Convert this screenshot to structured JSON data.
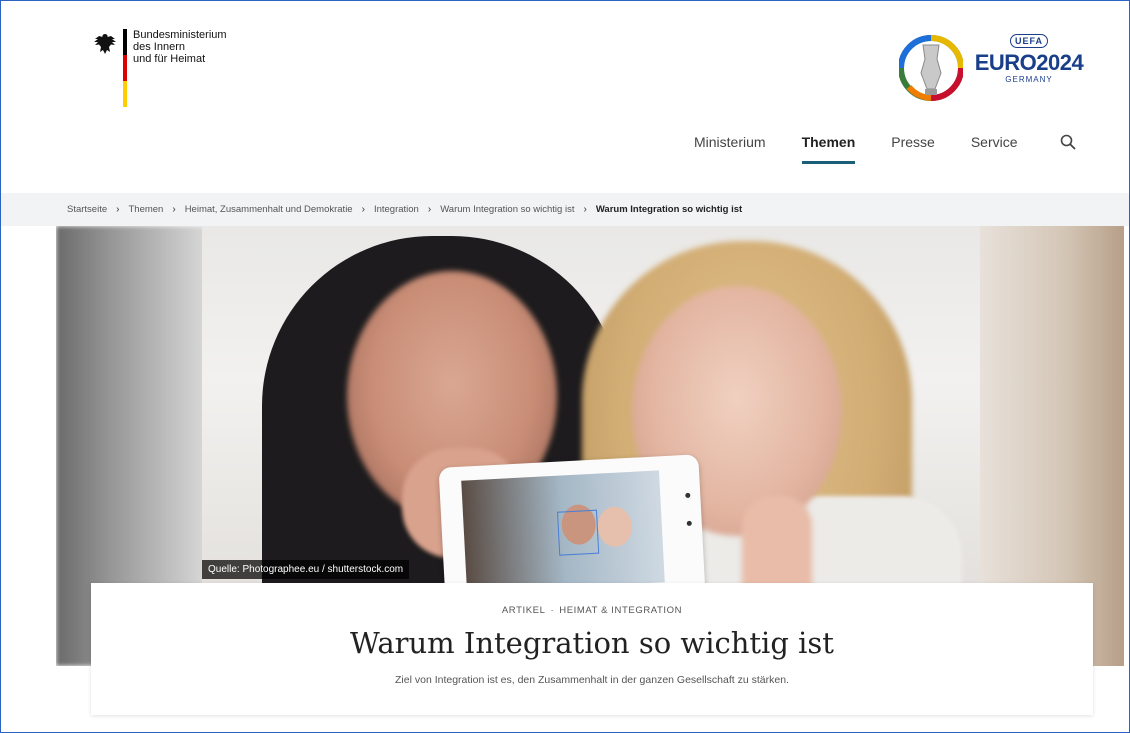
{
  "header": {
    "logo": {
      "lines": [
        "Bundesministerium",
        "des Innern",
        "und für Heimat"
      ],
      "flag_colors": [
        "#000000",
        "#dd0000",
        "#ffce00"
      ],
      "icon": "federal-eagle-icon"
    },
    "sponsor": {
      "badge": "UEFA",
      "title": "EURO2024",
      "subtitle": "GERMANY"
    },
    "nav": {
      "items": [
        "Ministerium",
        "Themen",
        "Presse",
        "Service"
      ],
      "active": "Themen",
      "search_icon": "magnifier-icon"
    }
  },
  "breadcrumb": [
    "Startseite",
    "Themen",
    "Heimat, Zusammenhalt und Demokratie",
    "Integration",
    "Warum Integration so wichtig ist",
    "Warum Integration so wichtig ist"
  ],
  "hero": {
    "caption": "Quelle: Photographee.eu / shutterstock.com"
  },
  "article": {
    "kicker_type": "ARTIKEL",
    "kicker_topic": "HEIMAT & INTEGRATION",
    "kicker_separator": "·",
    "title": "Warum Integration so wichtig ist",
    "subtitle": "Ziel von Integration ist es, den Zusammenhalt in der ganzen Gesellschaft zu stärken."
  },
  "colors": {
    "accent": "#1b5e78",
    "breadcrumb_bg": "#f2f3f5",
    "euro_blue": "#1a3f8a"
  }
}
